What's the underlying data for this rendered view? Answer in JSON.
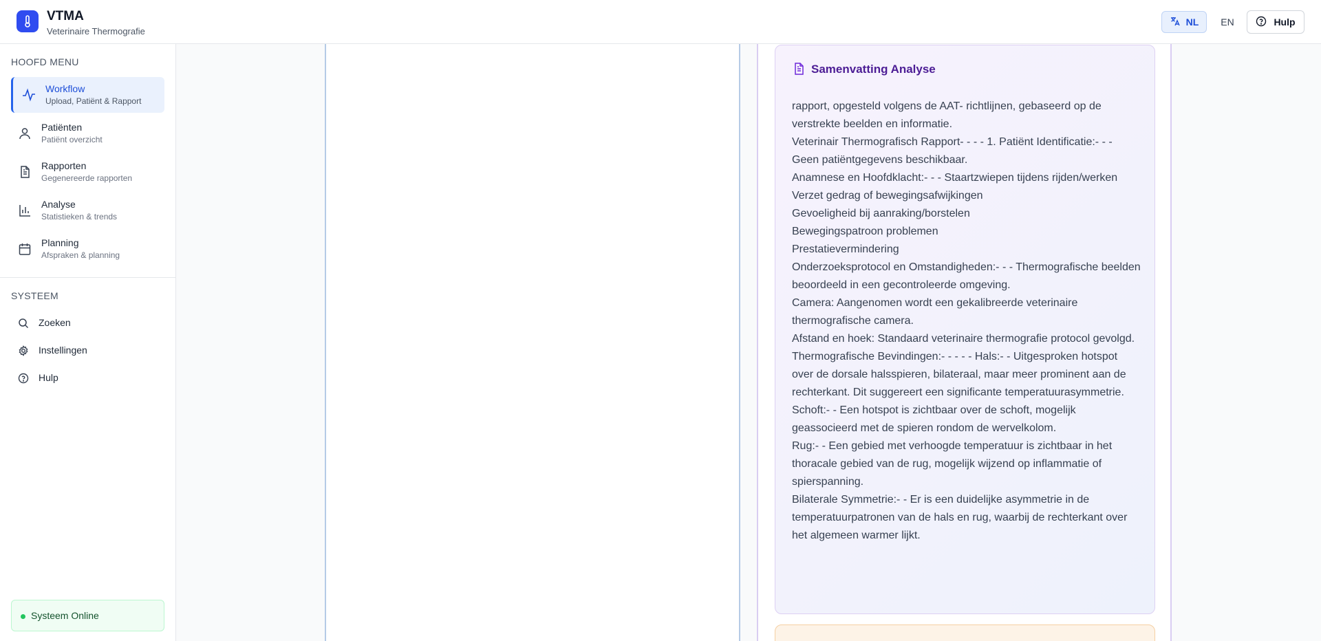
{
  "header": {
    "title": "VTMA",
    "subtitle": "Veterinaire Thermografie",
    "lang_nl": "NL",
    "lang_en": "EN",
    "help_label": "Hulp",
    "accent_color": "#2f4cf0"
  },
  "sidebar": {
    "main_menu_label": "HOOFD MENU",
    "items": [
      {
        "title": "Workflow",
        "subtitle": "Upload, Patiënt & Rapport",
        "icon": "activity-icon",
        "active": true
      },
      {
        "title": "Patiënten",
        "subtitle": "Patiënt overzicht",
        "icon": "user-icon"
      },
      {
        "title": "Rapporten",
        "subtitle": "Gegenereerde rapporten",
        "icon": "file-text-icon"
      },
      {
        "title": "Analyse",
        "subtitle": "Statistieken & trends",
        "icon": "bar-chart-icon"
      },
      {
        "title": "Planning",
        "subtitle": "Afspraken & planning",
        "icon": "calendar-icon"
      }
    ],
    "system_label": "SYSTEEM",
    "system_items": [
      {
        "label": "Zoeken",
        "icon": "search-icon"
      },
      {
        "label": "Instellingen",
        "icon": "gear-icon"
      },
      {
        "label": "Hulp",
        "icon": "help-circle-icon"
      }
    ],
    "status": "Systeem Online",
    "status_color": "#22c55e"
  },
  "summary": {
    "title": "Samenvatting Analyse",
    "lines": [
      "rapport, opgesteld volgens de AAT- richtlijnen, gebaseerd op de verstrekte beelden en informatie.",
      "Veterinair Thermografisch Rapport- - - - 1. Patiënt Identificatie:- - - Geen patiëntgegevens beschikbaar.",
      "Anamnese en Hoofdklacht:- - - Staartzwiepen tijdens rijden/werken",
      "Verzet gedrag of bewegingsafwijkingen",
      "Gevoeligheid bij aanraking/borstelen",
      "Bewegingspatroon problemen",
      "Prestatievermindering",
      "Onderzoeksprotocol en Omstandigheden:- - - Thermografische beelden beoordeeld in een gecontroleerde omgeving.",
      "Camera: Aangenomen wordt een gekalibreerde veterinaire thermografische camera.",
      "Afstand en hoek: Standaard veterinaire thermografie protocol gevolgd.",
      "Thermografische Bevindingen:- - - - - Hals:- - Uitgesproken hotspot over de dorsale halsspieren, bilateraal, maar meer prominent aan de rechterkant. Dit suggereert een significante temperatuurasymmetrie.",
      "Schoft:- - Een hotspot is zichtbaar over de schoft, mogelijk geassocieerd met de spieren rondom de wervelkolom.",
      "Rug:- - Een gebied met verhoogde temperatuur is zichtbaar in het thoracale gebied van de rug, mogelijk wijzend op inflammatie of spierspanning.",
      "Bilaterale Symmetrie:- - Er is een duidelijke asymmetrie in de temperatuurpatronen van de hals en rug, waarbij de rechterkant over het algemeen warmer lijkt."
    ]
  }
}
